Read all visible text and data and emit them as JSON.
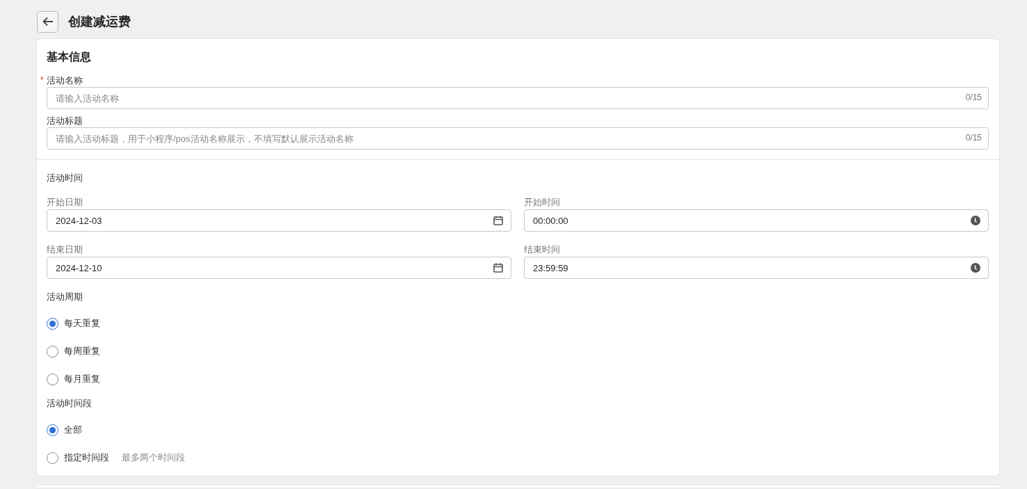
{
  "header": {
    "title": "创建减运费"
  },
  "basic_info": {
    "title": "基本信息",
    "fields": [
      {
        "label": "活动名称",
        "required_mark": "*",
        "placeholder": "请输入活动名称",
        "counter": "0/15"
      },
      {
        "label": "活动标题",
        "placeholder": "请输入活动标题，用于小程序/pos活动名称展示，不填写默认展示活动名称",
        "counter": "0/15"
      }
    ]
  },
  "time": {
    "title": "活动时间",
    "fields": [
      {
        "label": "开始日期",
        "value": "2024-12-03",
        "kind": "date"
      },
      {
        "label": "开始时间",
        "value": "00:00:00",
        "kind": "time"
      },
      {
        "label": "结束日期",
        "value": "2024-12-10",
        "kind": "date"
      },
      {
        "label": "结束时间",
        "value": "23:59:59",
        "kind": "time"
      }
    ]
  },
  "cycle": {
    "title": "活动周期",
    "options": [
      {
        "label": "每天重复",
        "selected": true
      },
      {
        "label": "每周重复",
        "selected": false
      },
      {
        "label": "每月重复",
        "selected": false
      }
    ]
  },
  "period": {
    "title": "活动时间段",
    "options": [
      {
        "label": "全部",
        "selected": true
      },
      {
        "label": "指定时间段",
        "selected": false,
        "hint": "最多两个时间段"
      }
    ]
  }
}
